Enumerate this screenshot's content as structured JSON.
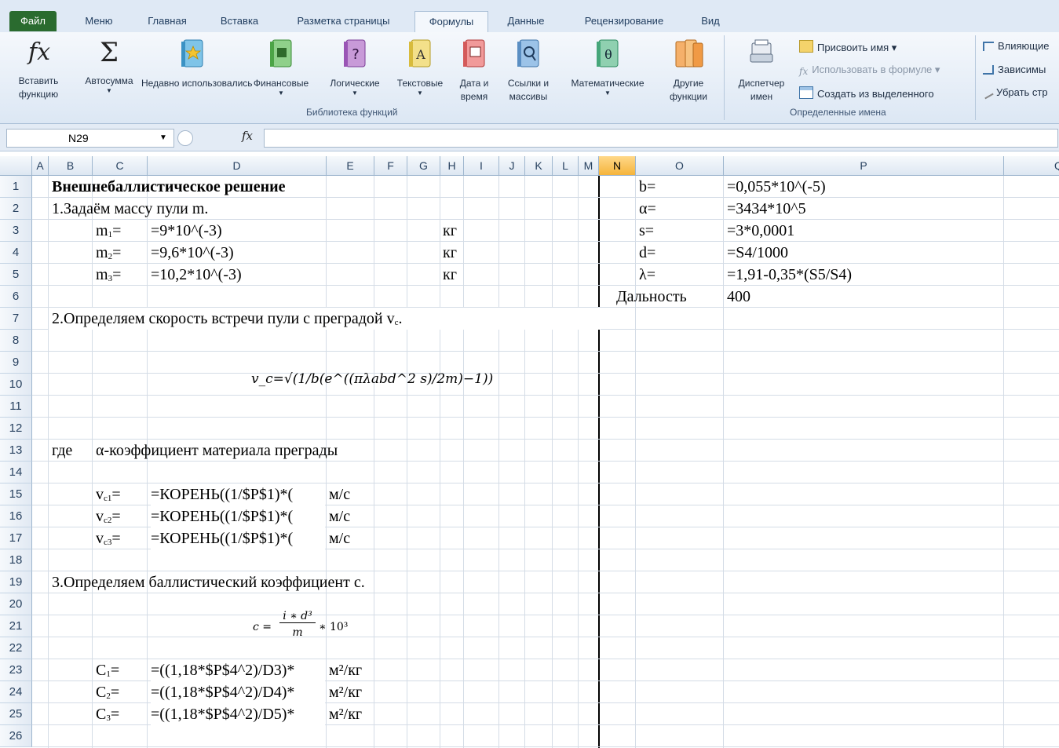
{
  "tabs": [
    "Файл",
    "Меню",
    "Главная",
    "Вставка",
    "Разметка страницы",
    "Формулы",
    "Данные",
    "Рецензирование",
    "Вид"
  ],
  "ribbon": {
    "insert_function": "Вставить функцию",
    "autosum": "Автосумма",
    "recent": "Недавно использовались",
    "financial": "Финансовые",
    "logical": "Логические",
    "text": "Текстовые",
    "datetime": "Дата и время",
    "lookup": "Ссылки и массивы",
    "math": "Математические",
    "other": "Другие функции",
    "group_library": "Библиотека функций",
    "name_manager": "Диспетчер имен",
    "define_name": "Присвоить имя",
    "use_in_formula": "Использовать в формуле",
    "create_from_selection": "Создать из выделенного",
    "group_names": "Определенные имена",
    "trace_precedents": "Влияющие",
    "trace_dependents": "Зависимы",
    "remove_arrows": "Убрать стр"
  },
  "formula_bar": {
    "name_box": "N29",
    "fx": "fx",
    "content": ""
  },
  "columns": [
    "A",
    "B",
    "C",
    "D",
    "E",
    "F",
    "G",
    "H",
    "I",
    "J",
    "K",
    "L",
    "M",
    "N",
    "O",
    "P",
    "Q"
  ],
  "selected_column": "N",
  "rows": [
    "1",
    "2",
    "3",
    "4",
    "5",
    "6",
    "7",
    "8",
    "9",
    "10",
    "11",
    "12",
    "13",
    "14",
    "15",
    "16",
    "17",
    "18",
    "19",
    "20",
    "21",
    "22",
    "23",
    "24",
    "25",
    "26"
  ],
  "cells": {
    "B1": "Внешнебаллистическое решение",
    "B2": "1.Задаём массу пули m.",
    "C3_base": "m",
    "C3_sub": "1",
    "C3_eq": "=",
    "D3": "=9*10^(-3)",
    "H3": "кг",
    "C4_base": "m",
    "C4_sub": "2",
    "C4_eq": "=",
    "D4": "=9,6*10^(-3)",
    "H4": "кг",
    "C5_base": "m",
    "C5_sub": "3",
    "C5_eq": "=",
    "D5": "=10,2*10^(-3)",
    "H5": "кг",
    "B7": "2.Определяем скорость встречи пули с преградой v",
    "B7_sub": "c",
    "B7_end": ".",
    "formula_vc": "v_c=√(1/b(e^((πλabd^2 s)/2m)−1))",
    "B13": "где",
    "C13": "α-коэффициент материала преграды",
    "C15_base": "v",
    "C15_sub": "c1",
    "C15_eq": "=",
    "D15": "=КОРЕНЬ((1/$P$1)*(",
    "E15": "м/с",
    "C16_base": "v",
    "C16_sub": "c2",
    "C16_eq": "=",
    "D16": "=КОРЕНЬ((1/$P$1)*(",
    "E16": "м/с",
    "C17_base": "v",
    "C17_sub": "c3",
    "C17_eq": "=",
    "D17": "=КОРЕНЬ((1/$P$1)*(",
    "E17": "м/с",
    "B19": "3.Определяем баллистический коэффициент с.",
    "formula_c_lhs": "c =",
    "formula_c_num": "i ∗ d³",
    "formula_c_den": "m",
    "formula_c_rhs": "∗ 10³",
    "C23_base": "C",
    "C23_sub": "1",
    "C23_eq": "=",
    "D23": "=((1,18*$P$4^2)/D3)*",
    "E23": "м²/кг",
    "C24_base": "C",
    "C24_sub": "2",
    "C24_eq": "=",
    "D24": "=((1,18*$P$4^2)/D4)*",
    "E24": "м²/кг",
    "C25_base": "C",
    "C25_sub": "3",
    "C25_eq": "=",
    "D25": "=((1,18*$P$4^2)/D5)*",
    "E25": "м²/кг",
    "O1": "b=",
    "P1": "=0,055*10^(-5)",
    "O2": "α=",
    "P2": "=3434*10^5",
    "O3": "s=",
    "P3": "=3*0,0001",
    "O4": "d=",
    "P4": "=S4/1000",
    "O5": "λ=",
    "P5": "=1,91-0,35*(S5/S4)",
    "N6": "Дальность",
    "P6": "400"
  }
}
